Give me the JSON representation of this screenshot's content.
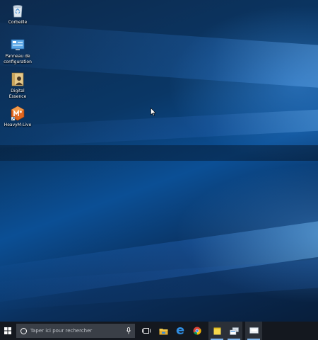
{
  "desktop": {
    "icons": [
      {
        "label": "Corbeille",
        "icon": "recycle-bin-icon"
      },
      {
        "label": "Panneau de configuration",
        "icon": "control-panel-icon"
      },
      {
        "label": "Digital Essence",
        "icon": "digital-essence-icon"
      },
      {
        "label": "HeavyM-Live",
        "icon": "heavym-live-icon"
      }
    ]
  },
  "taskbar": {
    "search_placeholder": "Taper ici pour rechercher",
    "items": [
      {
        "icon": "task-view-icon"
      },
      {
        "icon": "file-explorer-icon"
      },
      {
        "icon": "edge-icon"
      },
      {
        "icon": "chrome-icon"
      },
      {
        "icon": "sticky-notes-icon",
        "active": true
      },
      {
        "icon": "app-window-icon",
        "active": true
      },
      {
        "icon": "screen-icon",
        "active": true
      }
    ]
  },
  "colors": {
    "taskbar": "#14181f",
    "search_box": "#3a3f47",
    "accent": "#0b4f95",
    "active_underline": "#7fb6ee"
  }
}
